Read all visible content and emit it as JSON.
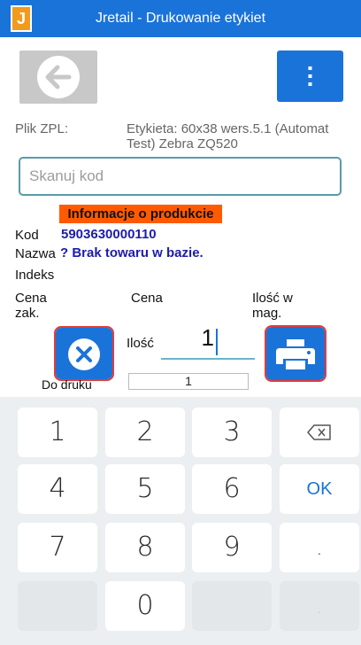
{
  "app": {
    "title": "Jretail - Drukowanie etykiet",
    "logo_text": "J"
  },
  "toolbar": {
    "back_icon": "arrow-left-circle-icon",
    "menu_icon": "dots-vertical-icon"
  },
  "zpl": {
    "label": "Plik ZPL:",
    "value": "Etykieta: 60x38 wers.5.1 (Automat Test) Zebra ZQ520"
  },
  "scan": {
    "placeholder": "Skanuj kod",
    "value": ""
  },
  "product": {
    "header": "Informacje o produkcie",
    "kod_label": "Kod",
    "kod_value": "5903630000110",
    "nazwa_label": "Nazwa",
    "nazwa_value": "? Brak towaru w bazie.",
    "indeks_label": "Indeks",
    "cena_zak_label": "Cena zak.",
    "cena_label": "Cena",
    "ilosc_mag_label": "Ilość w mag."
  },
  "quantity": {
    "label": "Ilość",
    "value": "1"
  },
  "print": {
    "do_druku_label": "Do druku",
    "do_druku_value": "1"
  },
  "keypad": {
    "keys": [
      "1",
      "2",
      "3",
      "4",
      "5",
      "6",
      "7",
      "8",
      "9",
      "0"
    ],
    "ok_label": "OK",
    "dot_label": ".",
    "comma_label": ","
  },
  "colors": {
    "primary": "#1a73d9",
    "accent_orange": "#ff5a00",
    "logo_orange": "#f29a1d",
    "highlight_red": "#e23b3b",
    "input_border": "#5a9ba8"
  }
}
